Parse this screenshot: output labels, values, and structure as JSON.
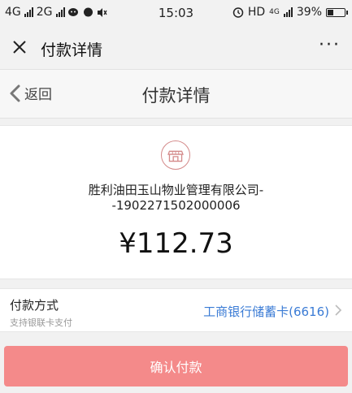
{
  "status_bar": {
    "net1": "4G",
    "net2": "2G",
    "time": "15:03",
    "hd": "HD",
    "net3": "4G",
    "battery_percent": "39%",
    "battery_level": 0.39
  },
  "wechat_header": {
    "title": "付款详情",
    "more": "···"
  },
  "navbar": {
    "back_label": "返回",
    "title": "付款详情"
  },
  "merchant": {
    "name_line1": "胜利油田玉山物业管理有限公司-",
    "name_line2": "-1902271502000006",
    "amount": "¥112.73",
    "icon": "store-icon"
  },
  "payment": {
    "label": "付款方式",
    "sublabel": "支持银联卡支付",
    "card": "工商银行储蓄卡(6616)",
    "card_color": "#3a7bd5"
  },
  "confirm": {
    "label": "确认付款",
    "color": "#f48a8a"
  }
}
